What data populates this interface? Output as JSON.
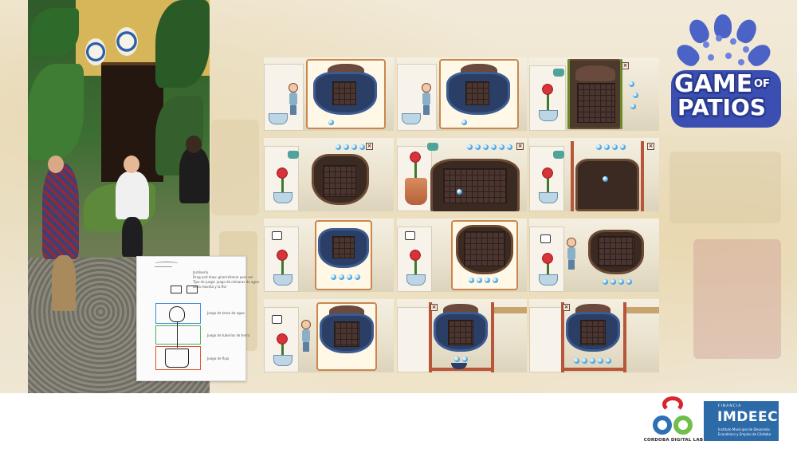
{
  "logo": {
    "word_game": "GAME",
    "word_of": "OF",
    "word_patios": "PATIOS",
    "colors": {
      "primary": "#3b4fb3",
      "accent": "#6d82de"
    }
  },
  "sketch": {
    "notes": [
      "Jardinería",
      "Drag and drop: girar/rellenar para ver",
      "Tipo de juego: juego de cámaras de agua",
      "de la maceta y la flor"
    ],
    "captions": [
      "Juego de tarea de agua",
      "Juego de tuberías de tierra",
      "Juego de flujo"
    ]
  },
  "sponsors": {
    "cordoba": "CORDOBA DIGITAL LAB",
    "financia": "FINANCIA",
    "imdeec": "IMDEEC",
    "imdeec_lines": [
      "Instituto Municipal de Desarrollo",
      "Económico y Empleo de Córdoba"
    ]
  },
  "panel_icons": {
    "close": "×",
    "rotate": "↻"
  }
}
